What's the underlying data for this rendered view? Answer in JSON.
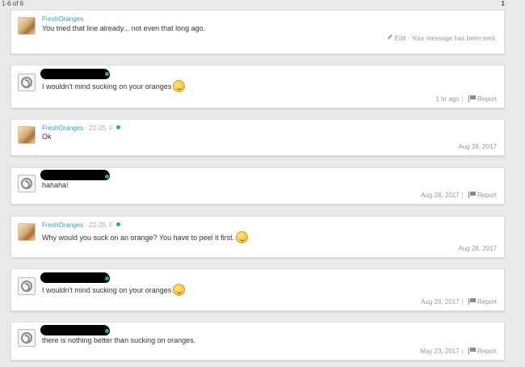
{
  "pagination": {
    "range": "1-6 of 6",
    "page": "1"
  },
  "messages": [
    {
      "author": "FreshOranges",
      "text": "You tried that line already... not even that long ago.",
      "edit_label": "Edit",
      "status": "· Your message has been sent."
    },
    {
      "text": "I wouldn't mind sucking on your oranges",
      "emoji": "winking-face",
      "timestamp": "1 hr ago",
      "report_label": "Report"
    },
    {
      "author": "FreshOranges",
      "author_details": "· 22-25, F",
      "text": "Ok",
      "timestamp": "Aug 28, 2017"
    },
    {
      "text": "hahaha!",
      "timestamp": "Aug 28, 2017",
      "report_label": "Report"
    },
    {
      "author": "FreshOranges",
      "author_details": "· 22-25, F",
      "text": "Why would you suck on an orange? You have to peel it first.",
      "emoji": "eye-roll-face",
      "timestamp": "Aug 28, 2017"
    },
    {
      "text": "I wouldn't mind sucking on your oranges",
      "emoji": "winking-face",
      "timestamp": "Aug 28, 2017",
      "report_label": "Report"
    },
    {
      "text": "there is nothing better than sucking on oranges.",
      "timestamp": "May 23, 2017",
      "report_label": "Report"
    }
  ],
  "colors": {
    "author": "#3a9bb0",
    "online": "#28b463",
    "background": "#eaeaea"
  }
}
